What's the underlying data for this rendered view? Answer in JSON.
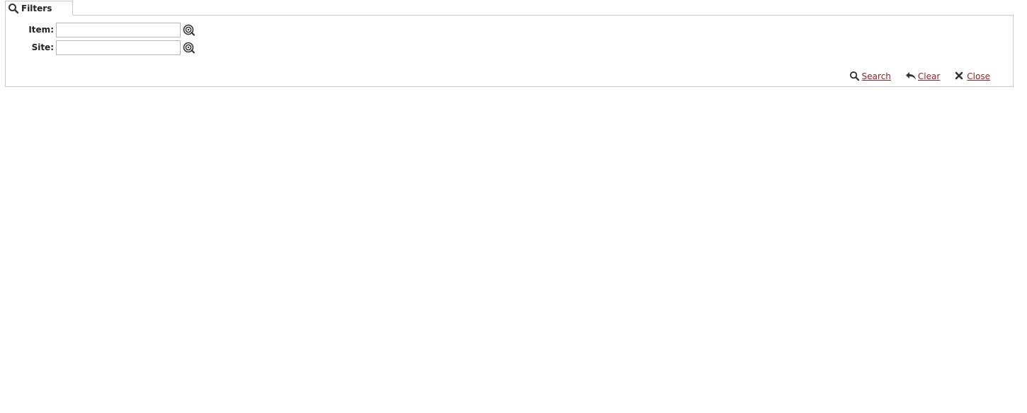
{
  "filters": {
    "tab_label": "Filters",
    "tab_icon": "search-icon",
    "fields": [
      {
        "label": "Item:",
        "value": "",
        "placeholder": "",
        "lookup_icon": "lookup-icon"
      },
      {
        "label": "Site:",
        "value": "",
        "placeholder": "",
        "lookup_icon": "lookup-icon"
      }
    ],
    "actions": {
      "search_label": "Search",
      "search_icon": "search-icon",
      "clear_label": "Clear",
      "clear_icon": "undo-arrow-icon",
      "close_label": "Close",
      "close_icon": "close-icon"
    },
    "colors": {
      "link": "#9b1c1c",
      "border": "#c8c8c8",
      "icon": "#333333"
    }
  }
}
